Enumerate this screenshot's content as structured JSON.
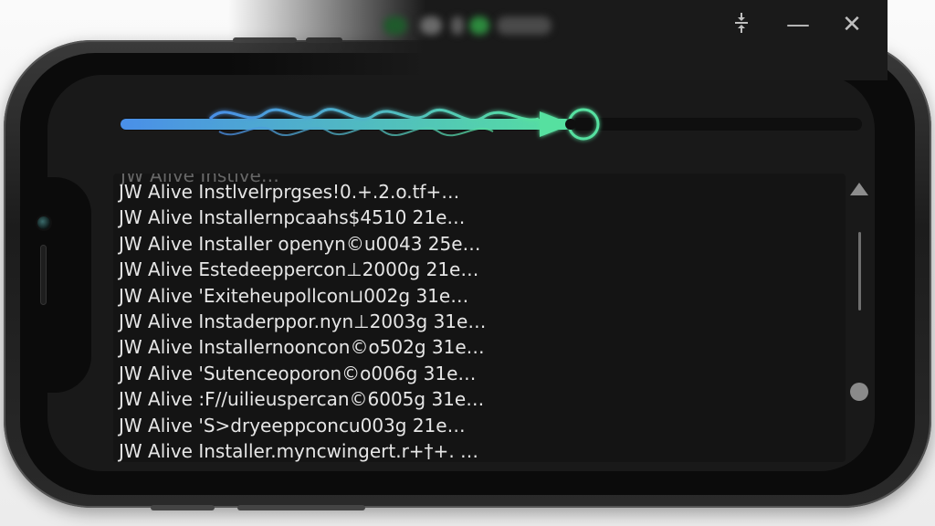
{
  "window": {
    "controls": {
      "pin_icon": "pin-icon",
      "minimize": "—",
      "close": "✕"
    }
  },
  "installer": {
    "progress": 0.62,
    "colors": {
      "start": "#4a8fe8",
      "end": "#56e0a0",
      "track": "#0f0f0f"
    }
  },
  "log": {
    "lines": [
      "JW Alive Instlvelrprgses!0.+.2.o.tf+…",
      "JW Alive Installernpcaahs$4510 21e…",
      "JW Alive Installer openyn©u0043 25e…",
      "JW Alive Estedeeppercon⊥2000g 21e…",
      "JW Alive 'Exiteheupollcon⊔002g 31e…",
      "JW Alive Instaderppor.nyn⊥2003g 31e…",
      "JW Alive Installernooncon©o502g 31e…",
      "JW Alive 'Sutenceoporon©o006g 31e…",
      "JW Alive :F//uilieuspercan©6005g 31e…",
      "JW Alive 'S>dryeeppconcu003g 21e…",
      "JW Alive Installer.myncwingert.r+†+. …"
    ]
  }
}
